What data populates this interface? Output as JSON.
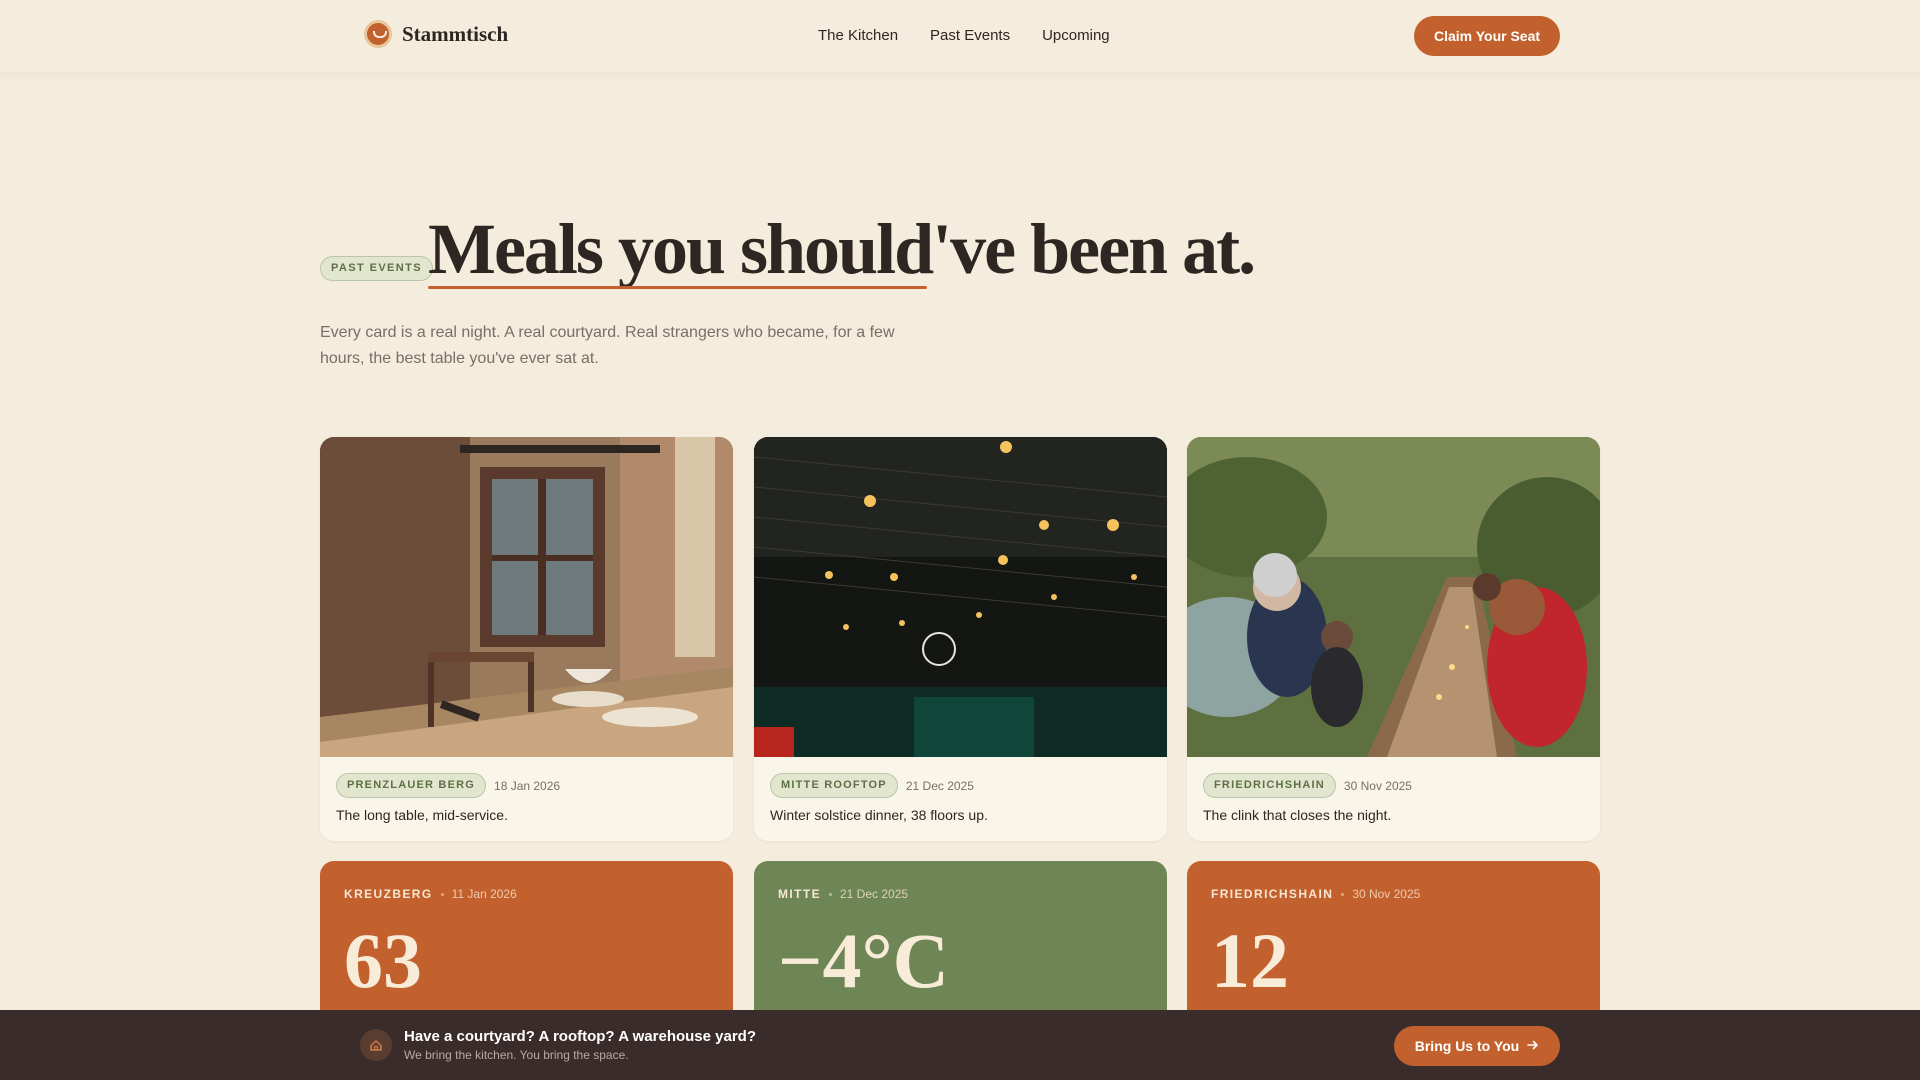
{
  "brand": {
    "name": "Stammtisch",
    "logo_icon": "chef-pot-icon"
  },
  "nav": {
    "links": [
      "The Kitchen",
      "Past Events",
      "Upcoming"
    ],
    "cta": "Claim Your Seat"
  },
  "hero": {
    "badge": "PAST EVENTS",
    "title": "Meals you should've been at.",
    "subtitle": "Every card is a real night. A real courtyard. Real strangers who became, for a few hours, the best table you've ever sat at."
  },
  "photo_cards": [
    {
      "location": "PRENZLAUER BERG",
      "date": "18 Jan 2026",
      "caption": "The long table, mid-service.",
      "image": "rustic-table-window-photo"
    },
    {
      "location": "MITTE ROOFTOP",
      "date": "21 Dec 2025",
      "caption": "Winter solstice dinner, 38 floors up.",
      "image": "rooftop-string-lights-photo"
    },
    {
      "location": "FRIEDRICHSHAIN",
      "date": "30 Nov 2025",
      "caption": "The clink that closes the night.",
      "image": "garden-long-table-guests-photo"
    }
  ],
  "stat_cards": [
    {
      "location": "KREUZBERG",
      "date": "11 Jan 2026",
      "value": "63",
      "color": "#c2612d"
    },
    {
      "location": "MITTE",
      "date": "21 Dec 2025",
      "value": "−4°C",
      "color": "#6e8555"
    },
    {
      "location": "FRIEDRICHSHAIN",
      "date": "30 Nov 2025",
      "value": "12",
      "color": "#c2612d"
    }
  ],
  "bottom_bar": {
    "icon": "home-icon",
    "title": "Have a courtyard? A rooftop? A warehouse yard?",
    "subtitle": "We bring the kitchen. You bring the space.",
    "cta": "Bring Us to You",
    "cta_icon": "arrow-right-icon"
  },
  "colors": {
    "background": "#f4ecdc",
    "accent": "#c2612d",
    "green": "#6e8555",
    "dark": "#3a2c2a"
  }
}
